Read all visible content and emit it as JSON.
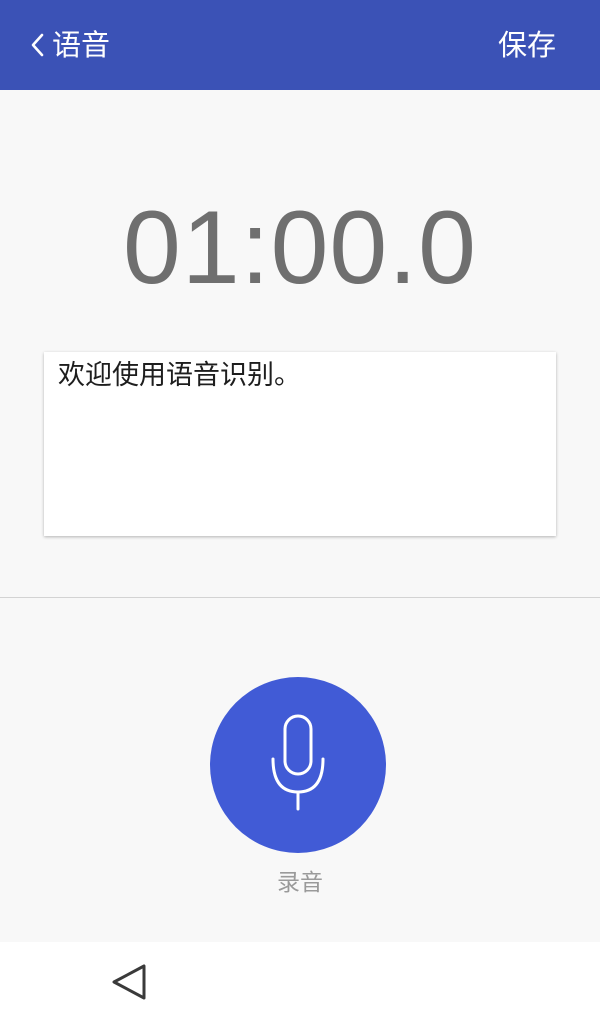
{
  "header": {
    "back_label": "语音",
    "back_icon": "chevron-left-icon",
    "save_label": "保存"
  },
  "timer": {
    "value": "01:00.0"
  },
  "transcript": {
    "text": "欢迎使用语音识别。"
  },
  "record": {
    "icon": "microphone-icon",
    "label": "录音"
  },
  "navigation": {
    "back_icon": "triangle-back-icon"
  },
  "colors": {
    "app_bar": "#3b52b6",
    "record_button": "#415bd6",
    "background": "#f8f8f8",
    "timer_text": "#6f6f6f"
  }
}
